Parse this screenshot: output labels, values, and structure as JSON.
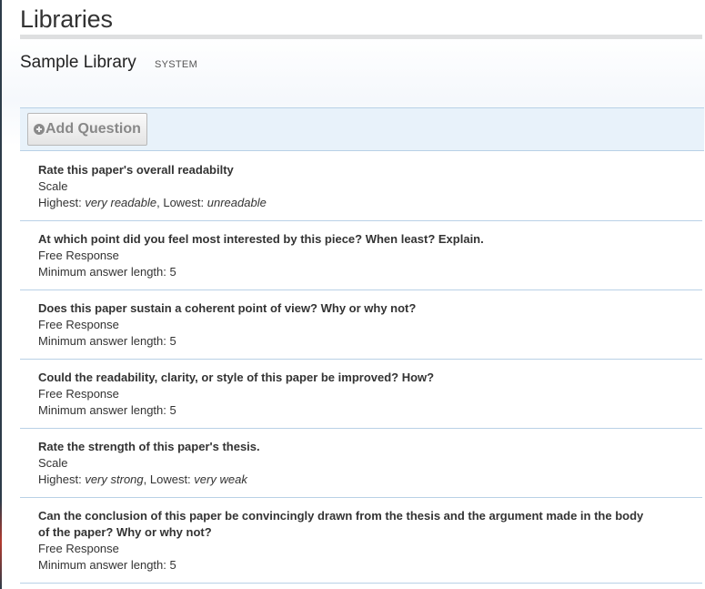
{
  "page": {
    "title": "Libraries"
  },
  "library": {
    "name": "Sample Library",
    "tag": "SYSTEM"
  },
  "toolbar": {
    "add_label": "Add Question",
    "add_icon": "plus-circle-icon"
  },
  "questions": [
    {
      "text": "Rate this paper's overall readabilty",
      "type": "Scale",
      "highest_label": "Highest:",
      "highest_value": "very readable",
      "lowest_label": ", Lowest:",
      "lowest_value": "unreadable"
    },
    {
      "text": "At which point did you feel most interested by this piece? When least? Explain.",
      "type": "Free Response",
      "detail": "Minimum answer length: 5"
    },
    {
      "text": "Does this paper sustain a coherent point of view? Why or why not?",
      "type": "Free Response",
      "detail": "Minimum answer length: 5"
    },
    {
      "text": "Could the readability, clarity, or style of this paper be improved? How?",
      "type": "Free Response",
      "detail": "Minimum answer length: 5"
    },
    {
      "text": "Rate the strength of this paper's thesis.",
      "type": "Scale",
      "highest_label": "Highest:",
      "highest_value": "very strong",
      "lowest_label": ", Lowest:",
      "lowest_value": "very weak"
    },
    {
      "text": "Can the conclusion of this paper be convincingly drawn from the thesis and the argument made in the body of the paper? Why or why not?",
      "type": "Free Response",
      "detail": "Minimum answer length: 5"
    }
  ],
  "colors": {
    "toolbar_bg": "#e8f2fa",
    "divider": "#b9d1e6",
    "text": "#333333"
  }
}
